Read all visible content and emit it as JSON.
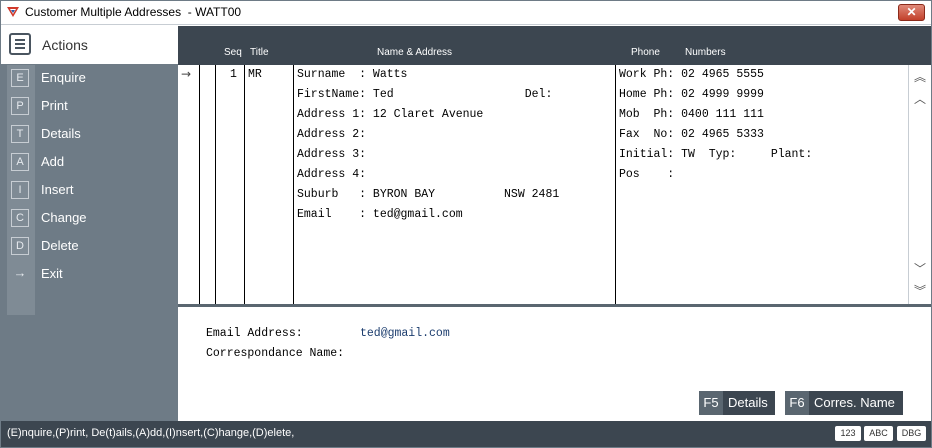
{
  "window": {
    "title": "Customer Multiple Addresses  - WATT00",
    "close_label": "✕"
  },
  "sidebar": {
    "actions_label": "Actions",
    "items": [
      {
        "key": "E",
        "label": "Enquire"
      },
      {
        "key": "P",
        "label": "Print"
      },
      {
        "key": "T",
        "label": "Details"
      },
      {
        "key": "A",
        "label": "Add"
      },
      {
        "key": "I",
        "label": "Insert"
      },
      {
        "key": "C",
        "label": "Change"
      },
      {
        "key": "D",
        "label": "Delete"
      },
      {
        "key": "→",
        "label": "Exit"
      }
    ]
  },
  "grid": {
    "headers": {
      "seq": "Seq",
      "title": "Title",
      "name_address": "Name & Address",
      "phone": "Phone",
      "numbers": "Numbers"
    },
    "row": {
      "seq": "1",
      "title": "MR",
      "address_lines": [
        "Surname  : Watts",
        "FirstName: Ted                   Del:",
        "Address 1: 12 Claret Avenue",
        "Address 2:",
        "Address 3:",
        "Address 4:",
        "Suburb   : BYRON BAY          NSW 2481",
        "Email    : ted@gmail.com"
      ],
      "phone_lines": [
        "Work Ph: 02 4965 5555",
        "Home Ph: 02 4999 9999",
        "Mob  Ph: 0400 111 111",
        "Fax  No: 02 4965 5333",
        "Initial: TW  Typ:     Plant:",
        "Pos    :"
      ]
    }
  },
  "details": {
    "email_label": "Email Address:",
    "email_value": "ted@gmail.com",
    "corr_label": "Correspondance Name:",
    "buttons": [
      {
        "key": "F5",
        "label": "Details"
      },
      {
        "key": "F6",
        "label": "Corres. Name"
      }
    ]
  },
  "statusbar": {
    "text": "(E)nquire,(P)rint, De(t)ails,(A)dd,(I)nsert,(C)hange,(D)elete,",
    "indicators": [
      "123",
      "ABC",
      "DBG"
    ]
  }
}
